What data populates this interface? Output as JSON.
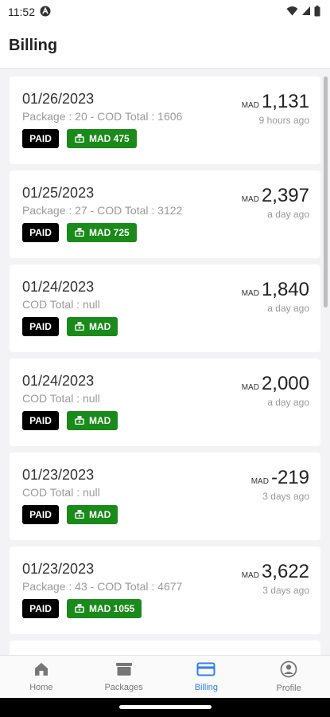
{
  "status": {
    "time": "11:52"
  },
  "header": {
    "title": "Billing"
  },
  "cards": [
    {
      "date": "01/26/2023",
      "sub": "Package : 20 -  COD Total : 1606",
      "paid": "PAID",
      "mad": "MAD 475",
      "currency": "MAD",
      "amount": "1,131",
      "ago": "9 hours ago"
    },
    {
      "date": "01/25/2023",
      "sub": "Package : 27 -  COD Total : 3122",
      "paid": "PAID",
      "mad": "MAD 725",
      "currency": "MAD",
      "amount": "2,397",
      "ago": "a day ago"
    },
    {
      "date": "01/24/2023",
      "sub": " COD Total : null",
      "paid": "PAID",
      "mad": "MAD",
      "currency": "MAD",
      "amount": "1,840",
      "ago": "a day ago"
    },
    {
      "date": "01/24/2023",
      "sub": " COD Total : null",
      "paid": "PAID",
      "mad": "MAD",
      "currency": "MAD",
      "amount": "2,000",
      "ago": "a day ago"
    },
    {
      "date": "01/23/2023",
      "sub": " COD Total : null",
      "paid": "PAID",
      "mad": "MAD",
      "currency": "MAD",
      "amount": "-219",
      "ago": "3 days ago"
    },
    {
      "date": "01/23/2023",
      "sub": "Package : 43 -  COD Total : 4677",
      "paid": "PAID",
      "mad": "MAD 1055",
      "currency": "MAD",
      "amount": "3,622",
      "ago": "3 days ago"
    }
  ],
  "nav": {
    "home": "Home",
    "packages": "Packages",
    "billing": "Billing",
    "profile": "Profile"
  }
}
